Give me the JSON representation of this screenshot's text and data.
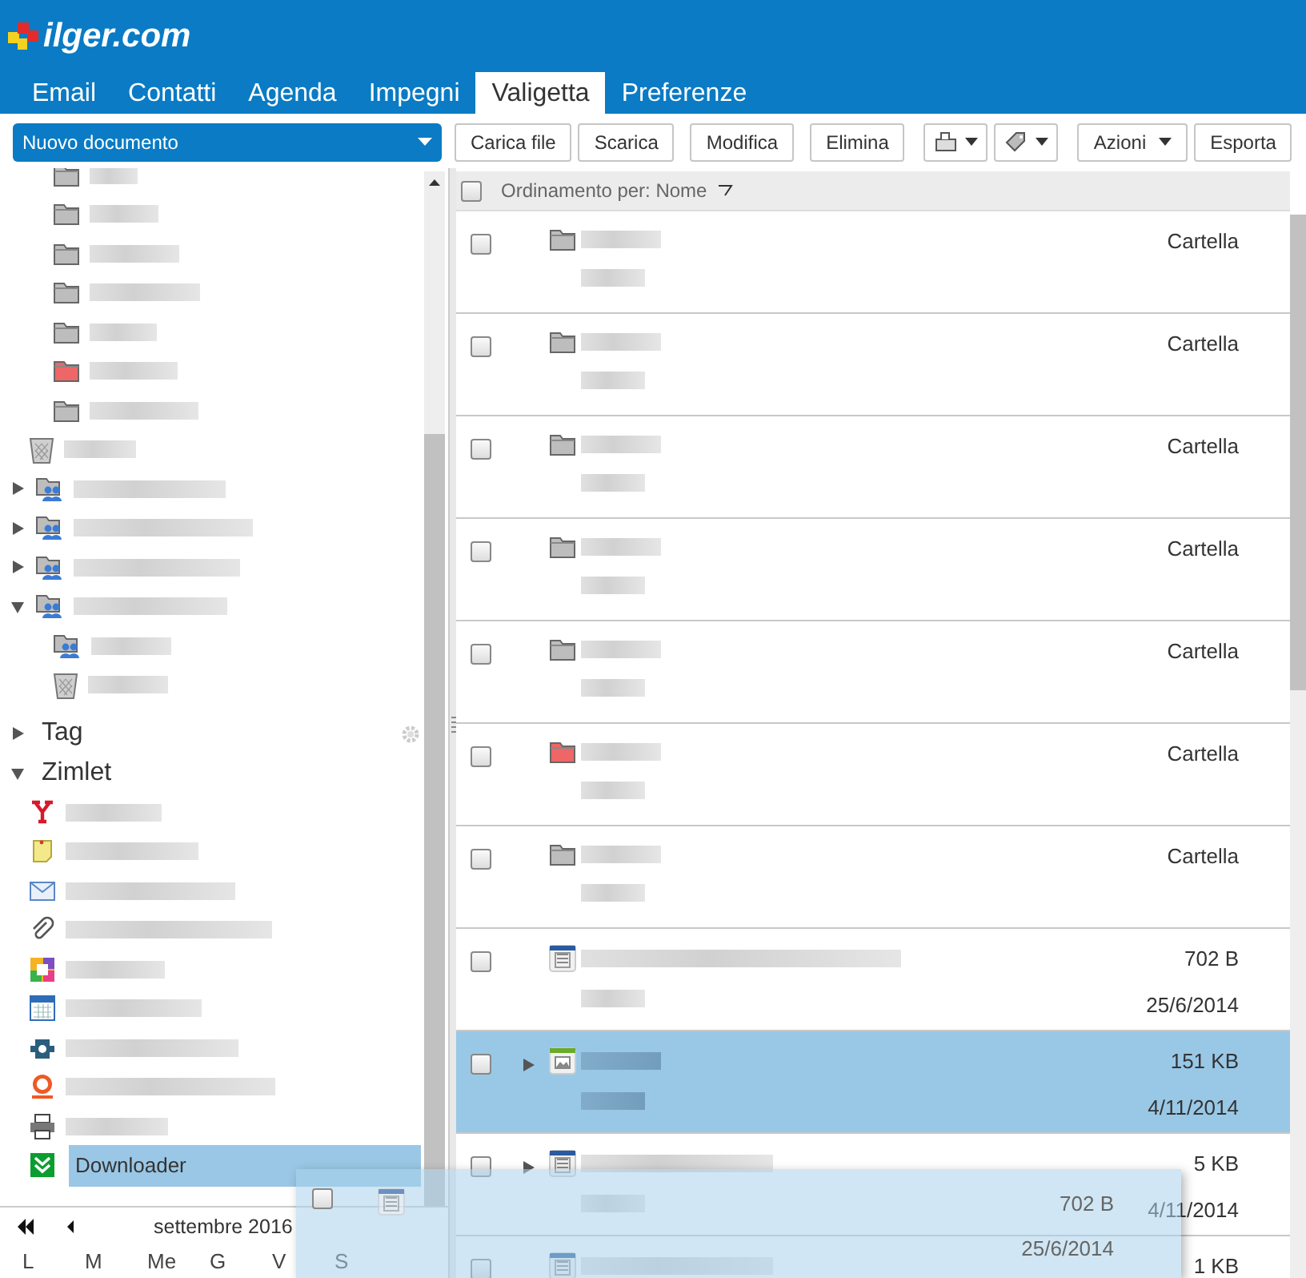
{
  "logo": {
    "text": "ilger.com"
  },
  "tabs": [
    {
      "label": "Email",
      "selected": false
    },
    {
      "label": "Contatti",
      "selected": false
    },
    {
      "label": "Agenda",
      "selected": false
    },
    {
      "label": "Impegni",
      "selected": false
    },
    {
      "label": "Valigetta",
      "selected": true
    },
    {
      "label": "Preferenze",
      "selected": false
    }
  ],
  "new_menu": {
    "label": "Nuovo documento"
  },
  "toolbar": [
    {
      "kind": "button",
      "label": "Carica file"
    },
    {
      "kind": "button",
      "label": "Scarica"
    },
    {
      "kind": "button",
      "label": "Modifica"
    },
    {
      "kind": "button",
      "label": "Elimina"
    },
    {
      "kind": "icon-menu"
    },
    {
      "kind": "icon-menu"
    },
    {
      "kind": "menu",
      "label": "Azioni"
    },
    {
      "kind": "button",
      "label": "Esporta"
    }
  ],
  "sidebar": {
    "folders": [
      {
        "kind": "folder",
        "color": "#bdbdbd"
      },
      {
        "kind": "folder",
        "color": "#bdbdbd"
      },
      {
        "kind": "folder",
        "color": "#bdbdbd"
      },
      {
        "kind": "folder",
        "color": "#bdbdbd"
      },
      {
        "kind": "folder",
        "color": "#bdbdbd"
      },
      {
        "kind": "folder",
        "color": "#ee6666"
      },
      {
        "kind": "folder",
        "color": "#bdbdbd"
      },
      {
        "kind": "trash"
      }
    ],
    "shared": [
      {
        "kind": "shared",
        "expanded": false
      },
      {
        "kind": "shared",
        "expanded": false
      },
      {
        "kind": "shared",
        "expanded": false
      },
      {
        "kind": "shared",
        "expanded": true,
        "children": [
          {
            "kind": "shared"
          },
          {
            "kind": "trash"
          }
        ]
      }
    ],
    "sections": [
      {
        "label": "Tag",
        "expanded": false
      },
      {
        "label": "Zimlet",
        "expanded": true
      }
    ],
    "zimlets": [
      {
        "kind": "yahoo",
        "selected": false
      },
      {
        "kind": "note",
        "selected": false
      },
      {
        "kind": "mail",
        "selected": false
      },
      {
        "kind": "clip",
        "selected": false
      },
      {
        "kind": "tiles",
        "selected": false
      },
      {
        "kind": "calendar",
        "selected": false
      },
      {
        "kind": "gear",
        "selected": false
      },
      {
        "kind": "zip",
        "selected": false
      },
      {
        "kind": "printer",
        "selected": false
      },
      {
        "kind": "download",
        "label": "Downloader",
        "selected": true
      }
    ]
  },
  "calendar": {
    "month": "settembre 2016",
    "weekdays": [
      "L",
      "M",
      "Me",
      "G",
      "V",
      "S"
    ]
  },
  "list": {
    "sort_label": "Ordinamento per: Nome",
    "select_all_checked": false,
    "rows": [
      {
        "kind": "folder",
        "color": "#bdbdbd",
        "type": "Cartella",
        "checked": false,
        "selected": false,
        "expandable": false
      },
      {
        "kind": "folder",
        "color": "#bdbdbd",
        "type": "Cartella",
        "checked": false,
        "selected": false,
        "expandable": false
      },
      {
        "kind": "folder",
        "color": "#bdbdbd",
        "type": "Cartella",
        "checked": false,
        "selected": false,
        "expandable": false
      },
      {
        "kind": "folder",
        "color": "#bdbdbd",
        "type": "Cartella",
        "checked": false,
        "selected": false,
        "expandable": false
      },
      {
        "kind": "folder",
        "color": "#bdbdbd",
        "type": "Cartella",
        "checked": false,
        "selected": false,
        "expandable": false
      },
      {
        "kind": "folder",
        "color": "#ee6666",
        "type": "Cartella",
        "checked": false,
        "selected": false,
        "expandable": false
      },
      {
        "kind": "folder",
        "color": "#bdbdbd",
        "type": "Cartella",
        "checked": false,
        "selected": false,
        "expandable": false
      },
      {
        "kind": "document",
        "size": "702 B",
        "date": "25/6/2014",
        "checked": false,
        "selected": false,
        "expandable": false
      },
      {
        "kind": "image",
        "size": "151 KB",
        "date": "4/11/2014",
        "checked": false,
        "selected": true,
        "expandable": true
      },
      {
        "kind": "document",
        "size": "5 KB",
        "date": "4/11/2014",
        "checked": false,
        "selected": false,
        "expandable": true
      },
      {
        "kind": "document",
        "size": "1 KB",
        "checked": false,
        "selected": false,
        "expandable": false
      }
    ]
  },
  "drag_preview": {
    "checked": false,
    "size": "702 B",
    "date": "25/6/2014"
  }
}
